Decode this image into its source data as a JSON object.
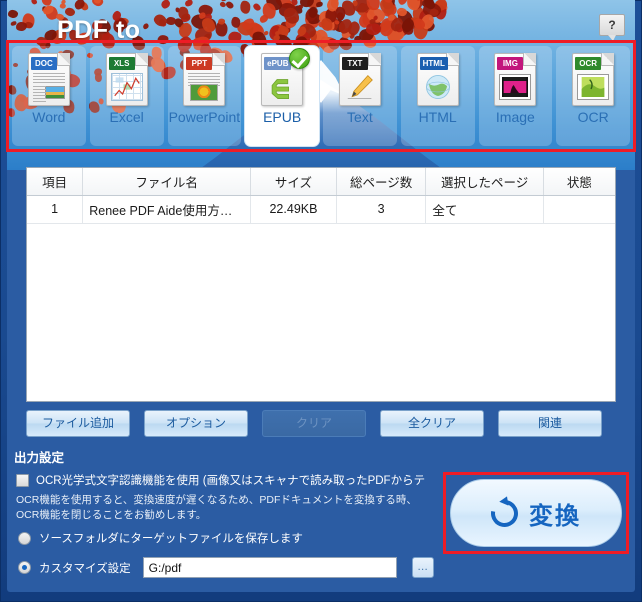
{
  "window": {
    "title": "PDF to",
    "help_label": "?"
  },
  "formats": {
    "items": [
      {
        "label": "Word",
        "tag": "DOC",
        "tag_color": "#2a6ec4",
        "icon": "word-file-icon",
        "selected": false
      },
      {
        "label": "Excel",
        "tag": "XLS",
        "tag_color": "#1d7a33",
        "icon": "excel-file-icon",
        "selected": false
      },
      {
        "label": "PowerPoint",
        "tag": "PPT",
        "tag_color": "#cc3a23",
        "icon": "powerpoint-file-icon",
        "selected": false
      },
      {
        "label": "EPUB",
        "tag": "ePUB",
        "tag_color": "#6f93c9",
        "icon": "epub-file-icon",
        "selected": true
      },
      {
        "label": "Text",
        "tag": "TXT",
        "tag_color": "#1e1e1e",
        "icon": "text-file-icon",
        "selected": false
      },
      {
        "label": "HTML",
        "tag": "HTML",
        "tag_color": "#1b5fb0",
        "icon": "html-file-icon",
        "selected": false
      },
      {
        "label": "Image",
        "tag": "IMG",
        "tag_color": "#c2167c",
        "icon": "image-file-icon",
        "selected": false
      },
      {
        "label": "OCR",
        "tag": "OCR",
        "tag_color": "#2f8a2c",
        "icon": "ocr-file-icon",
        "selected": false
      }
    ]
  },
  "table": {
    "headers": [
      "項目",
      "ファイル名",
      "サイズ",
      "総ページ数",
      "選択したページ",
      "状態"
    ],
    "rows": [
      {
        "index": "1",
        "filename": "Renee PDF Aide使用方…",
        "size": "22.49KB",
        "pages": "3",
        "selected_pages": "全て",
        "status": ""
      }
    ]
  },
  "actions": {
    "add_file": "ファイル追加",
    "options": "オプション",
    "clear": "クリア",
    "clear_all": "全クリア",
    "related": "関連"
  },
  "output": {
    "section_title": "出力設定",
    "ocr_checkbox_label": "OCR光学式文字認識機能を使用 (画像又はスキャナで読み取ったPDFからテ",
    "ocr_description": "OCR機能を使用すると、変換速度が遅くなるため、PDFドキュメントを変換する時、OCR機能を閉じることをお勧めします。",
    "radio_source_label": "ソースフォルダにターゲットファイルを保存します",
    "radio_custom_label": "カスタマイズ設定",
    "path_value": "G:/pdf",
    "browse_label": "…"
  },
  "convert": {
    "label": "変換"
  },
  "colors": {
    "accent_blue": "#1565c0",
    "panel_blue": "#2b5ca3",
    "highlight_red": "#ee1c26",
    "button_face": "#cde3f6",
    "check_green": "#3ea011"
  }
}
